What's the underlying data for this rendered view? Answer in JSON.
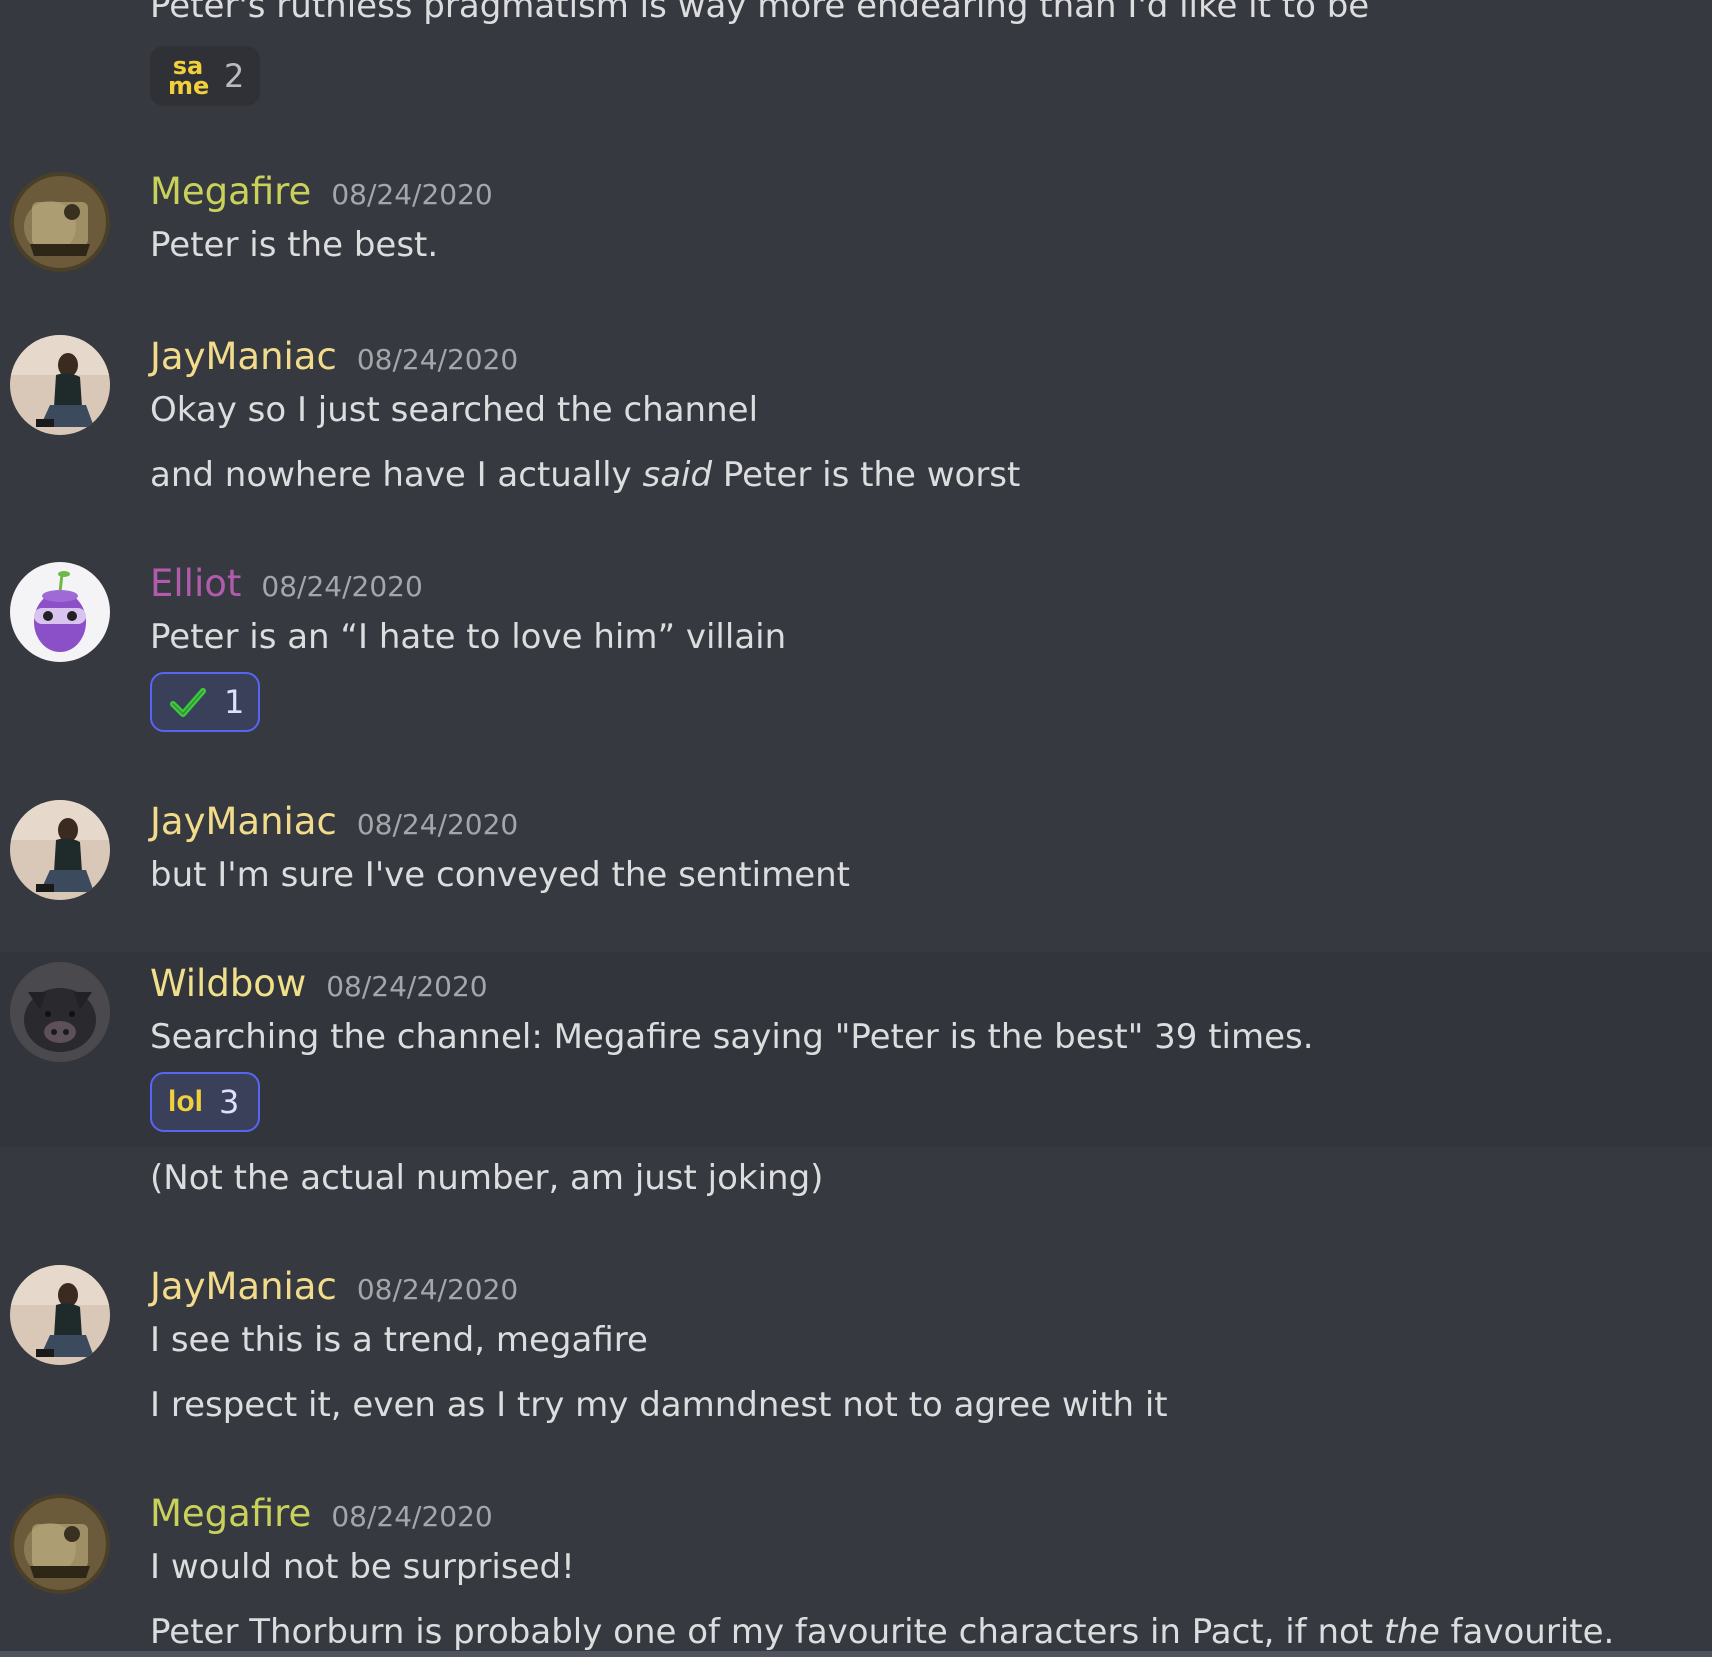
{
  "colors": {
    "background": "#36393f",
    "highlight_row": "#32353b",
    "megafire_name": "#c9d15b",
    "jaymaniac_name": "#f2dc8b",
    "elliot_name": "#b25bac",
    "wildbow_name": "#f1e08a",
    "timestamp": "#a3a6aa",
    "text": "#dcddde",
    "reaction_accent": "#5865f2"
  },
  "top_message": {
    "text": "Peter's ruthless pragmatism is way more endearing than I'd like it to be",
    "reaction": {
      "emoji": "same-emoji",
      "emoji_text_top": "sa",
      "emoji_text_bottom": "me",
      "count": "2"
    }
  },
  "messages": [
    {
      "username": "Megafire",
      "timestamp": "08/24/2020",
      "avatar": "megafire-avatar",
      "lines": [
        "Peter is the best."
      ]
    },
    {
      "username": "JayManiac",
      "timestamp": "08/24/2020",
      "avatar": "jaymaniac-avatar",
      "lines": [
        "Okay so I just searched the channel"
      ],
      "line2_before": "and nowhere have I actually ",
      "line2_em": "said",
      "line2_after": " Peter is the worst"
    },
    {
      "username": "Elliot",
      "timestamp": "08/24/2020",
      "avatar": "elliot-avatar",
      "lines": [
        "Peter is an “I hate to love him” villain"
      ],
      "reaction": {
        "emoji": "checkmark-emoji",
        "count": "1"
      }
    },
    {
      "username": "JayManiac",
      "timestamp": "08/24/2020",
      "avatar": "jaymaniac-avatar",
      "lines": [
        "but I'm sure I've conveyed the sentiment"
      ]
    },
    {
      "username": "Wildbow",
      "timestamp": "08/24/2020",
      "avatar": "wildbow-avatar",
      "lines": [
        "Searching the channel: Megafire saying \"Peter is the best\" 39 times."
      ],
      "reaction": {
        "emoji": "lol-emoji",
        "emoji_text": "lol",
        "count": "3"
      },
      "followup": "(Not the actual number, am just joking)"
    },
    {
      "username": "JayManiac",
      "timestamp": "08/24/2020",
      "avatar": "jaymaniac-avatar",
      "lines": [
        "I see this is a trend, megafire",
        "I respect it, even as I try my damndnest not to agree with it"
      ]
    },
    {
      "username": "Megafire",
      "timestamp": "08/24/2020",
      "avatar": "megafire-avatar",
      "lines": [
        "I would not be surprised!"
      ],
      "line2_before": "Peter Thorburn is probably one of my favourite characters in Pact, if not ",
      "line2_em": "the",
      "line2_after": " favourite."
    }
  ]
}
